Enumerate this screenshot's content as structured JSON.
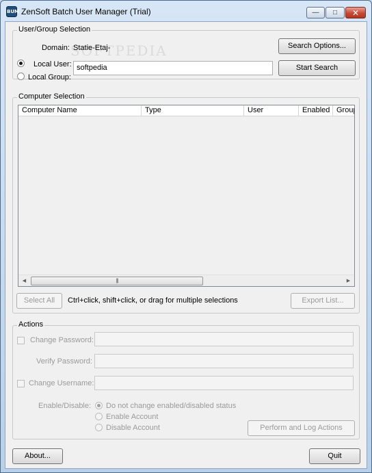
{
  "window": {
    "title": "ZenSoft Batch User Manager (Trial)",
    "icon_label": "BUM",
    "icon": "app-icon"
  },
  "user_group": {
    "title": "User/Group Selection",
    "domain_label": "Domain:",
    "domain_value": "Statie-Etaj-",
    "local_user_label": "Local User:",
    "local_group_label": "Local Group:",
    "search_value": "softpedia",
    "search_options_label": "Search Options...",
    "start_search_label": "Start Search"
  },
  "computer": {
    "title": "Computer Selection",
    "columns": [
      "Computer Name",
      "Type",
      "User",
      "Enabled",
      "Group"
    ],
    "select_all_label": "Select All",
    "hint": "Ctrl+click, shift+click, or drag for multiple selections",
    "export_label": "Export List...",
    "scroll_grip": "|||"
  },
  "actions": {
    "title": "Actions",
    "change_password_label": "Change Password:",
    "verify_password_label": "Verify Password:",
    "change_username_label": "Change Username:",
    "enable_disable_label": "Enable/Disable:",
    "opt_no_change": "Do not change enabled/disabled status",
    "opt_enable": "Enable Account",
    "opt_disable": "Disable Account",
    "perform_label": "Perform and Log Actions"
  },
  "footer": {
    "about_label": "About...",
    "quit_label": "Quit"
  },
  "colors": {
    "title_accent": "#1f4f7a",
    "close_red": "#c74a36"
  }
}
